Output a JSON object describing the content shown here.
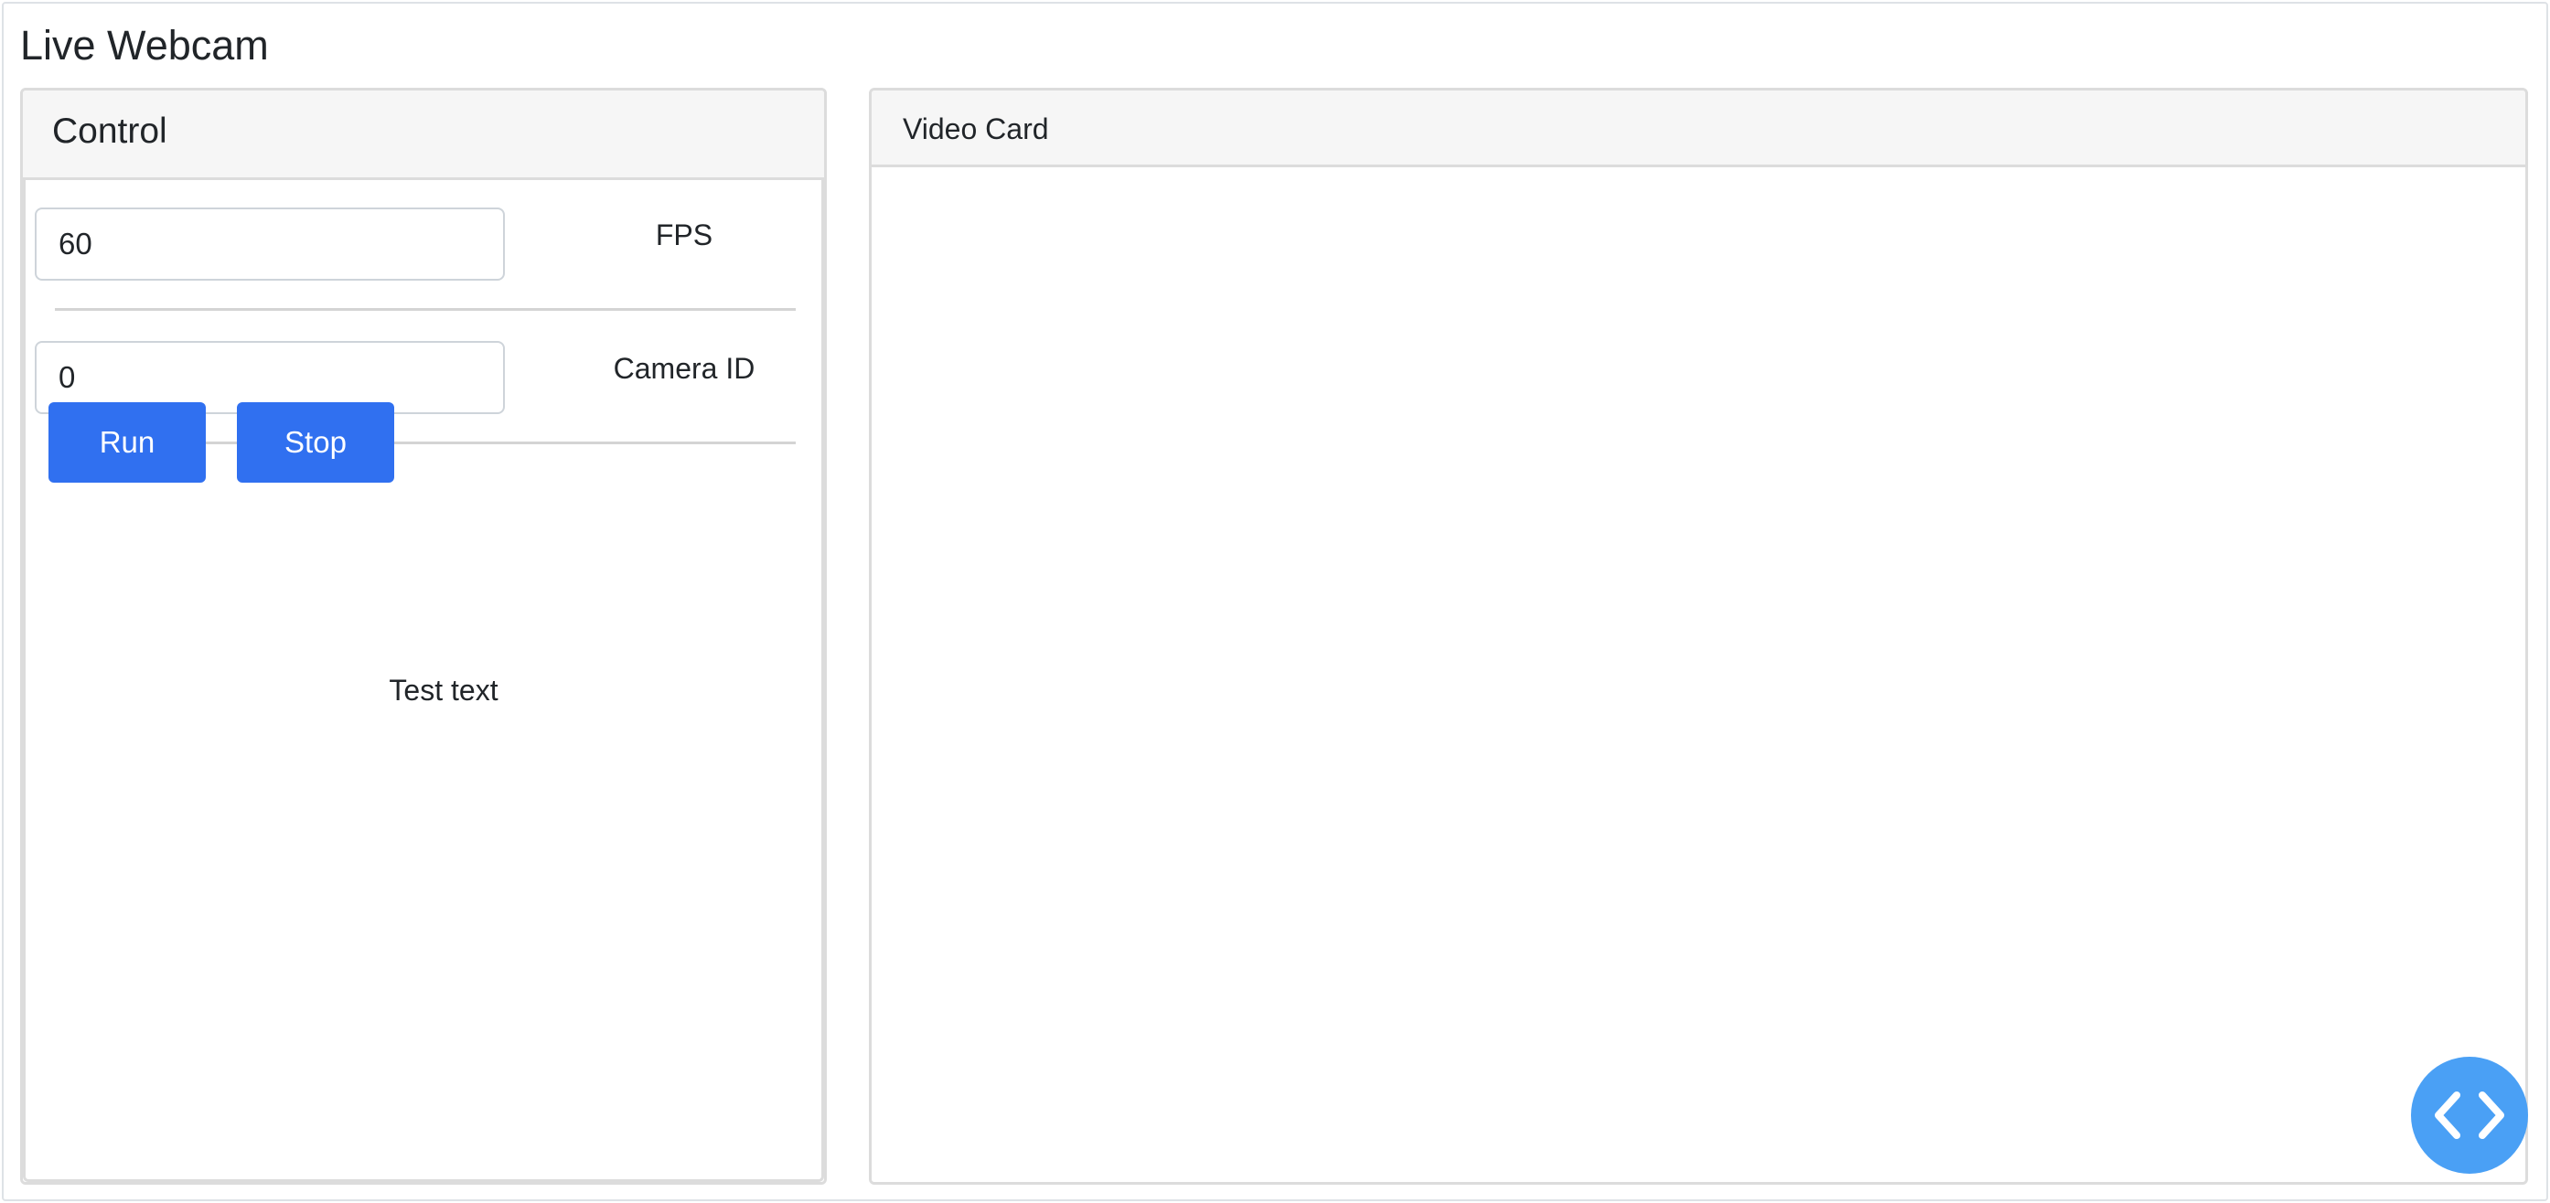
{
  "page": {
    "title": "Live Webcam"
  },
  "control": {
    "title": "Control",
    "fps": {
      "value": "60",
      "label": "FPS"
    },
    "camera": {
      "value": "0",
      "label": "Camera ID"
    },
    "run_label": "Run",
    "stop_label": "Stop",
    "status_text": "Test text"
  },
  "video": {
    "title": "Video Card"
  },
  "fab": {
    "icon": "code-icon"
  },
  "colors": {
    "button": "#3070f0",
    "fab": "#4aa0f5",
    "header_bg": "#f6f6f6",
    "border": "#dcdcdc"
  }
}
